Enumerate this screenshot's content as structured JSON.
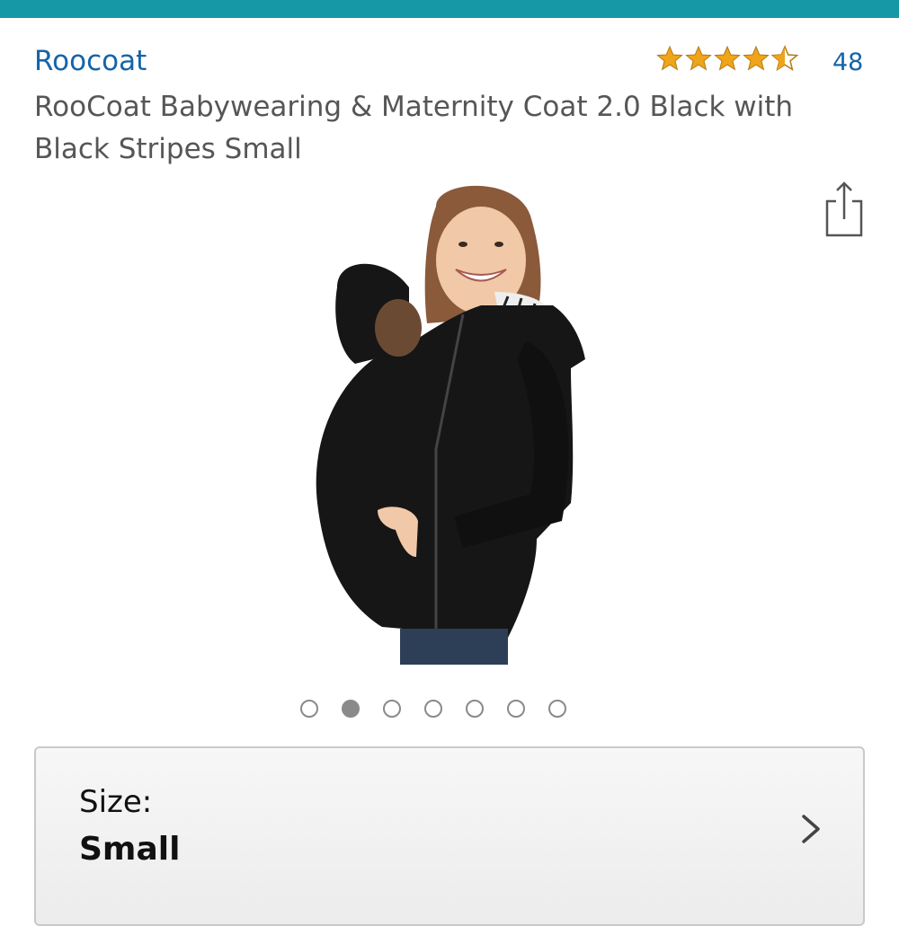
{
  "header": {
    "accent_color": "#1798a6"
  },
  "product": {
    "brand": "Roocoat",
    "title": "RooCoat Babywearing & Maternity Coat 2.0 Black with Black Stripes Small",
    "rating": 4.5,
    "rating_max": 5,
    "review_count": "48",
    "image_alt": "Woman wearing black babywearing coat with baby inside"
  },
  "gallery": {
    "total_images": 7,
    "current_index": 1
  },
  "size_selector": {
    "label": "Size:",
    "value": "Small"
  },
  "icons": {
    "share": "share-icon",
    "chevron": "chevron-right-icon",
    "star": "star-icon"
  },
  "colors": {
    "link": "#1564a8",
    "star": "#f0a41a",
    "text_gray": "#565656"
  }
}
